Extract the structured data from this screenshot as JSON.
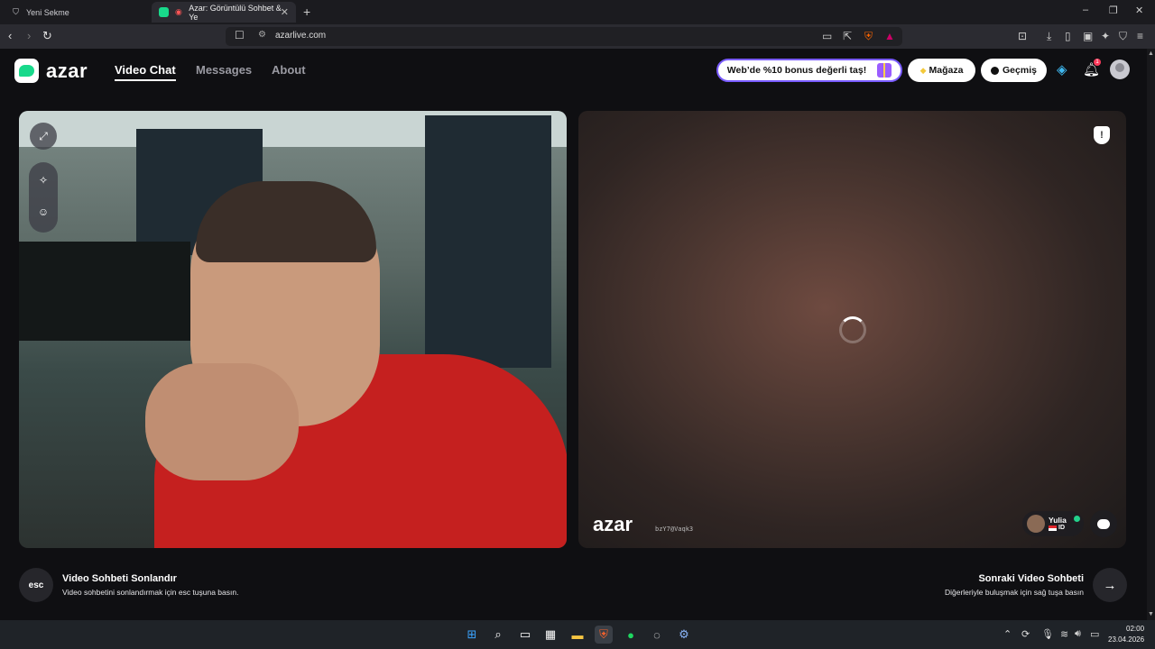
{
  "browser": {
    "tabs": [
      {
        "title": "Yeni Sekme",
        "active": false
      },
      {
        "title": "Azar: Görüntülü Sohbet & Ye",
        "active": true
      }
    ],
    "new_tab_symbol": "+",
    "url": "azarlive.com",
    "window_controls": [
      "–",
      "❐",
      "✕"
    ]
  },
  "header": {
    "logo_text": "azar",
    "nav": [
      "Video Chat",
      "Messages",
      "About"
    ],
    "active_nav": "Video Chat",
    "bonus_label": "Web’de %10 bonus değerli taş!",
    "store_label": "Mağaza",
    "history_label": "Geçmiş",
    "notification_count": "1"
  },
  "remote": {
    "watermark": "azar",
    "session_id": "bzY7@Vaqk3",
    "peer_name": "Yulia",
    "peer_country": "ID"
  },
  "footer": {
    "esc_key": "esc",
    "end_title": "Video Sohbeti Sonlandır",
    "end_sub": "Video sohbetini sonlandırmak için esc tuşuna basın.",
    "next_title": "Sonraki Video Sohbeti",
    "next_sub": "Diğerleriyle buluşmak için sağ tuşa basın",
    "next_symbol": "→"
  },
  "taskbar": {
    "time": "02:00",
    "date": "23.04.2026"
  },
  "colors": {
    "accent": "#18d98b",
    "bonus_border": "#7a5cff",
    "badge": "#ff3b5c"
  }
}
